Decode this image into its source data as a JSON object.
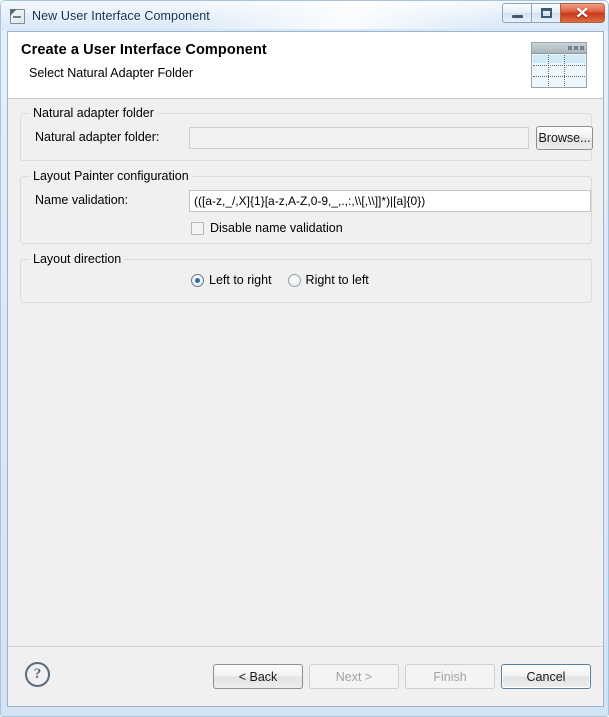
{
  "window": {
    "title": "New User Interface Component",
    "icon": "wizard-window-icon",
    "controls": {
      "minimize": "minimize-icon",
      "maximize": "maximize-icon",
      "close": "✕"
    }
  },
  "header": {
    "title": "Create a User Interface Component",
    "subtitle": "Select Natural Adapter Folder",
    "icon": "layout-window-icon"
  },
  "groups": {
    "adapter_folder": {
      "legend": "Natural adapter folder",
      "field_label": "Natural adapter folder:",
      "field_value": "",
      "field_placeholder": "",
      "browse_label": "Browse..."
    },
    "layout_painter": {
      "legend": "Layout Painter configuration",
      "field_label": "Name validation:",
      "field_value": "(([a-z,_/,X]{1}[a-z,A-Z,0-9,_,.,:,\\\\[,\\\\]]*)|[a]{0})",
      "checkbox_label": "Disable name validation",
      "checkbox_checked": false
    },
    "layout_direction": {
      "legend": "Layout direction",
      "options": [
        {
          "label": "Left to right",
          "selected": true
        },
        {
          "label": "Right to left",
          "selected": false
        }
      ]
    }
  },
  "buttonbar": {
    "help": "?",
    "buttons": [
      {
        "label": "< Back",
        "enabled": true
      },
      {
        "label": "Next >",
        "enabled": false
      },
      {
        "label": "Finish",
        "enabled": false
      },
      {
        "label": "Cancel",
        "enabled": true
      }
    ]
  },
  "colors": {
    "accent": "#2d6ea8",
    "title_text": "#12314f",
    "close_button": "#c8381c",
    "dialog_bg": "#f0f0f0",
    "header_bg": "#ffffff"
  }
}
